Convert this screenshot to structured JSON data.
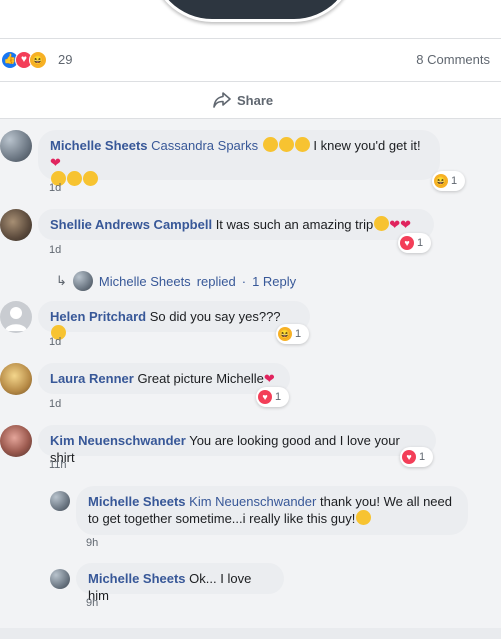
{
  "post": {
    "reaction_count": "29",
    "comments_count": "8 Comments",
    "share_label": "Share",
    "reaction_icons": [
      "like-icon",
      "love-icon",
      "haha-icon"
    ]
  },
  "comments": [
    {
      "author": "Michelle Sheets",
      "mention": "Cassandra Sparks",
      "text_before": "",
      "text": "I knew you'd get it!",
      "time": "1d",
      "reaction": {
        "icon": "haha",
        "count": "1"
      }
    },
    {
      "author": "Shellie Andrews Campbell",
      "text": "It was such an amazing trip",
      "time": "1d",
      "reaction": {
        "icon": "love",
        "count": "1"
      },
      "replies_summary": {
        "author": "Michelle Sheets",
        "replied": "replied",
        "separator": "·",
        "count_label": "1 Reply"
      }
    },
    {
      "author": "Helen Pritchard",
      "text": "So did you say yes???",
      "time": "1d",
      "reaction": {
        "icon": "haha",
        "count": "1"
      }
    },
    {
      "author": "Laura Renner",
      "text": "Great picture Michelle",
      "time": "1d",
      "reaction": {
        "icon": "love",
        "count": "1"
      }
    },
    {
      "author": "Kim Neuenschwander",
      "text": "You are looking good and I love your shirt",
      "time": "11h",
      "reaction": {
        "icon": "love",
        "count": "1"
      }
    }
  ],
  "replies": [
    {
      "author": "Michelle Sheets",
      "mention": "Kim Neuenschwander",
      "text_line1": "thank you! We all need",
      "text_line2": "to get together sometime...i really like this guy!",
      "time": "9h"
    },
    {
      "author": "Michelle Sheets",
      "text": "Ok... I love him",
      "time": "9h"
    }
  ],
  "colors": {
    "link": "#385898",
    "like": "#1877f2",
    "love": "#f33e58",
    "haha": "#f7b125"
  }
}
